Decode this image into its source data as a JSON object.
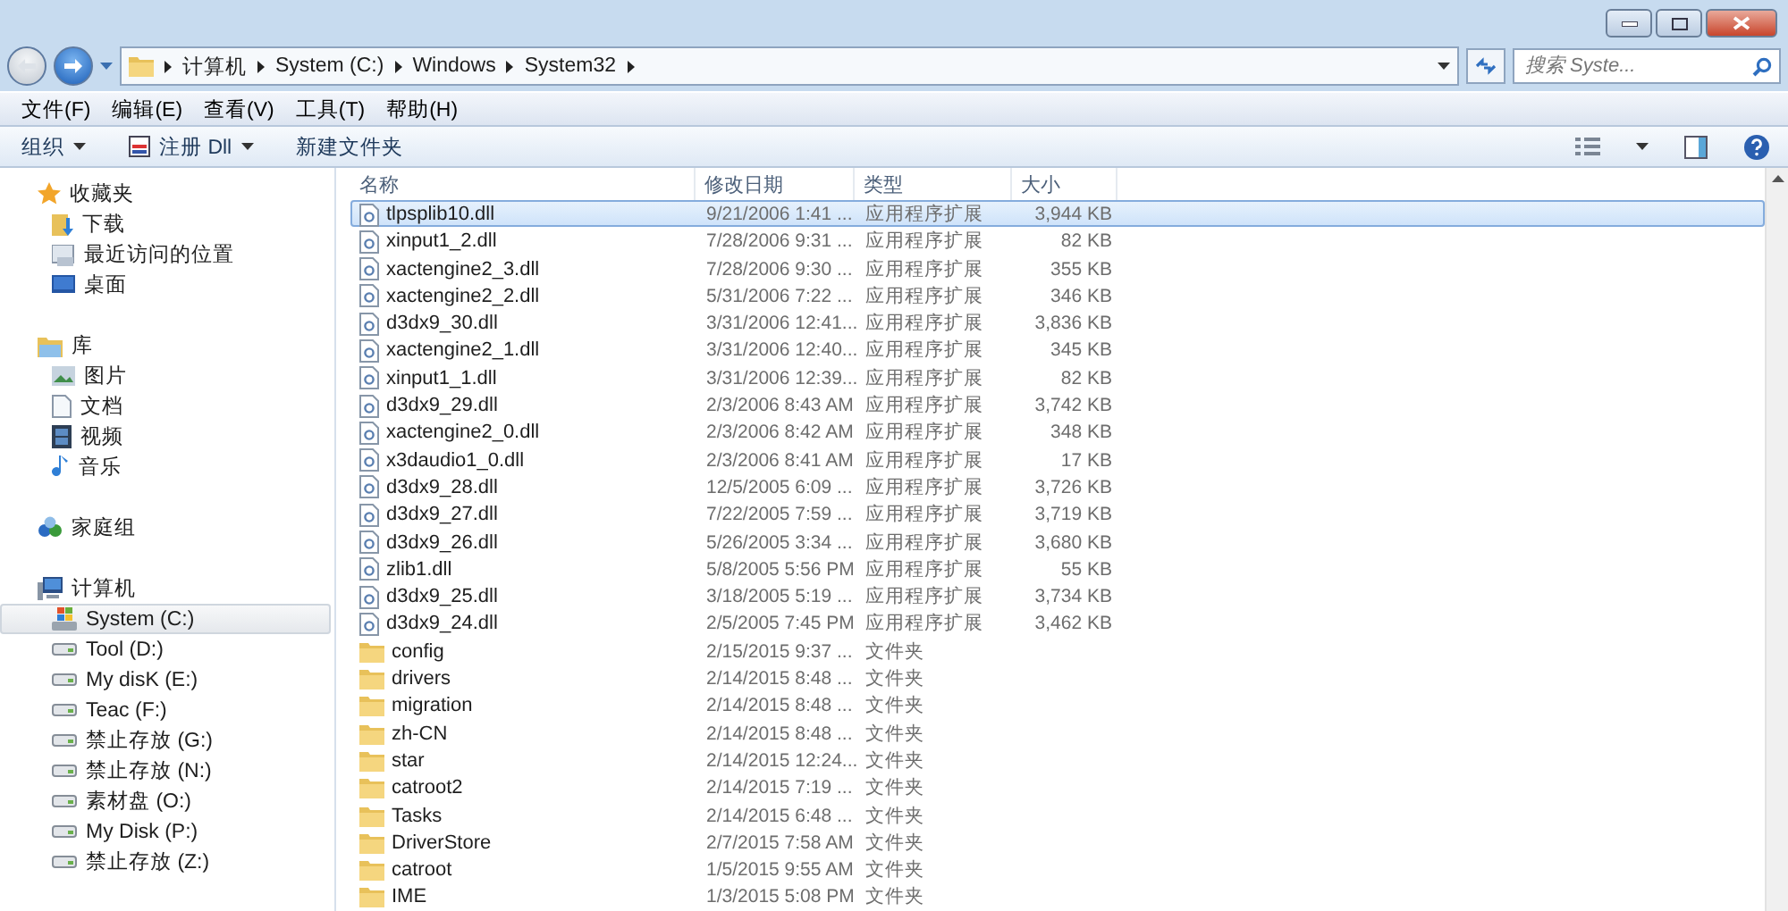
{
  "address": {
    "path": [
      "计算机",
      "System (C:)",
      "Windows",
      "System32"
    ]
  },
  "search": {
    "placeholder": "搜索 Syste..."
  },
  "menu": [
    "文件(F)",
    "编辑(E)",
    "查看(V)",
    "工具(T)",
    "帮助(H)"
  ],
  "toolbar": [
    {
      "label": "组织",
      "kind": "dropdown"
    },
    {
      "label": "注册 Dll",
      "kind": "icon-dropdown"
    },
    {
      "label": "新建文件夹",
      "kind": "plain"
    }
  ],
  "sidebar": [
    {
      "label": "收藏夹",
      "kind": "star",
      "selected": false,
      "children": [
        {
          "label": "下载",
          "kind": "download",
          "selected": false
        },
        {
          "label": "最近访问的位置",
          "kind": "recent",
          "selected": false
        },
        {
          "label": "桌面",
          "kind": "desktop",
          "selected": false
        }
      ]
    },
    {
      "label": "库",
      "kind": "library",
      "selected": false,
      "children": [
        {
          "label": "图片",
          "kind": "pictures",
          "selected": false
        },
        {
          "label": "文档",
          "kind": "documents",
          "selected": false
        },
        {
          "label": "视频",
          "kind": "videos",
          "selected": false
        },
        {
          "label": "音乐",
          "kind": "music",
          "selected": false
        }
      ]
    },
    {
      "label": "家庭组",
      "kind": "homegroup",
      "selected": false
    },
    {
      "label": "计算机",
      "kind": "computer",
      "selected": false,
      "children": [
        {
          "label": "System (C:)",
          "kind": "system-drive",
          "selected": true
        },
        {
          "label": "Tool (D:)",
          "kind": "drive",
          "selected": false
        },
        {
          "label": "My disK (E:)",
          "kind": "drive",
          "selected": false
        },
        {
          "label": "Teac (F:)",
          "kind": "drive",
          "selected": false
        },
        {
          "label": "禁止存放 (G:)",
          "kind": "drive",
          "selected": false
        },
        {
          "label": "禁止存放 (N:)",
          "kind": "drive",
          "selected": false
        },
        {
          "label": "素材盘 (O:)",
          "kind": "drive",
          "selected": false
        },
        {
          "label": "My Disk (P:)",
          "kind": "drive",
          "selected": false
        },
        {
          "label": "禁止存放 (Z:)",
          "kind": "drive",
          "selected": false
        }
      ]
    }
  ],
  "table": {
    "columns": [
      "名称",
      "修改日期",
      "类型",
      "大小"
    ],
    "rows": [
      {
        "kind": "dll",
        "selected": true,
        "name": "tlpsplib10.dll",
        "date": "9/21/2006 1:41 ...",
        "type": "应用程序扩展",
        "size": "3,944 KB"
      },
      {
        "kind": "dll",
        "selected": false,
        "name": "xinput1_2.dll",
        "date": "7/28/2006 9:31 ...",
        "type": "应用程序扩展",
        "size": "82 KB"
      },
      {
        "kind": "dll",
        "selected": false,
        "name": "xactengine2_3.dll",
        "date": "7/28/2006 9:30 ...",
        "type": "应用程序扩展",
        "size": "355 KB"
      },
      {
        "kind": "dll",
        "selected": false,
        "name": "xactengine2_2.dll",
        "date": "5/31/2006 7:22 ...",
        "type": "应用程序扩展",
        "size": "346 KB"
      },
      {
        "kind": "dll",
        "selected": false,
        "name": "d3dx9_30.dll",
        "date": "3/31/2006 12:41...",
        "type": "应用程序扩展",
        "size": "3,836 KB"
      },
      {
        "kind": "dll",
        "selected": false,
        "name": "xactengine2_1.dll",
        "date": "3/31/2006 12:40...",
        "type": "应用程序扩展",
        "size": "345 KB"
      },
      {
        "kind": "dll",
        "selected": false,
        "name": "xinput1_1.dll",
        "date": "3/31/2006 12:39...",
        "type": "应用程序扩展",
        "size": "82 KB"
      },
      {
        "kind": "dll",
        "selected": false,
        "name": "d3dx9_29.dll",
        "date": "2/3/2006 8:43 AM",
        "type": "应用程序扩展",
        "size": "3,742 KB"
      },
      {
        "kind": "dll",
        "selected": false,
        "name": "xactengine2_0.dll",
        "date": "2/3/2006 8:42 AM",
        "type": "应用程序扩展",
        "size": "348 KB"
      },
      {
        "kind": "dll",
        "selected": false,
        "name": "x3daudio1_0.dll",
        "date": "2/3/2006 8:41 AM",
        "type": "应用程序扩展",
        "size": "17 KB"
      },
      {
        "kind": "dll",
        "selected": false,
        "name": "d3dx9_28.dll",
        "date": "12/5/2005 6:09 ...",
        "type": "应用程序扩展",
        "size": "3,726 KB"
      },
      {
        "kind": "dll",
        "selected": false,
        "name": "d3dx9_27.dll",
        "date": "7/22/2005 7:59 ...",
        "type": "应用程序扩展",
        "size": "3,719 KB"
      },
      {
        "kind": "dll",
        "selected": false,
        "name": "d3dx9_26.dll",
        "date": "5/26/2005 3:34 ...",
        "type": "应用程序扩展",
        "size": "3,680 KB"
      },
      {
        "kind": "dll",
        "selected": false,
        "name": "zlib1.dll",
        "date": "5/8/2005 5:56 PM",
        "type": "应用程序扩展",
        "size": "55 KB"
      },
      {
        "kind": "dll",
        "selected": false,
        "name": "d3dx9_25.dll",
        "date": "3/18/2005 5:19 ...",
        "type": "应用程序扩展",
        "size": "3,734 KB"
      },
      {
        "kind": "dll",
        "selected": false,
        "name": "d3dx9_24.dll",
        "date": "2/5/2005 7:45 PM",
        "type": "应用程序扩展",
        "size": "3,462 KB"
      },
      {
        "kind": "folder",
        "selected": false,
        "name": "config",
        "date": "2/15/2015 9:37 ...",
        "type": "文件夹"
      },
      {
        "kind": "folder",
        "selected": false,
        "name": "drivers",
        "date": "2/14/2015 8:48 ...",
        "type": "文件夹"
      },
      {
        "kind": "folder",
        "selected": false,
        "name": "migration",
        "date": "2/14/2015 8:48 ...",
        "type": "文件夹"
      },
      {
        "kind": "folder",
        "selected": false,
        "name": "zh-CN",
        "date": "2/14/2015 8:48 ...",
        "type": "文件夹"
      },
      {
        "kind": "folder",
        "selected": false,
        "name": "star",
        "date": "2/14/2015 12:24...",
        "type": "文件夹"
      },
      {
        "kind": "folder",
        "selected": false,
        "name": "catroot2",
        "date": "2/14/2015 7:19 ...",
        "type": "文件夹"
      },
      {
        "kind": "folder",
        "selected": false,
        "name": "Tasks",
        "date": "2/14/2015 6:48 ...",
        "type": "文件夹"
      },
      {
        "kind": "folder",
        "selected": false,
        "name": "DriverStore",
        "date": "2/7/2015 7:58 AM",
        "type": "文件夹"
      },
      {
        "kind": "folder",
        "selected": false,
        "name": "catroot",
        "date": "1/5/2015 9:55 AM",
        "type": "文件夹"
      },
      {
        "kind": "folder",
        "selected": false,
        "name": "IME",
        "date": "1/3/2015 5:08 PM",
        "type": "文件夹"
      }
    ]
  }
}
